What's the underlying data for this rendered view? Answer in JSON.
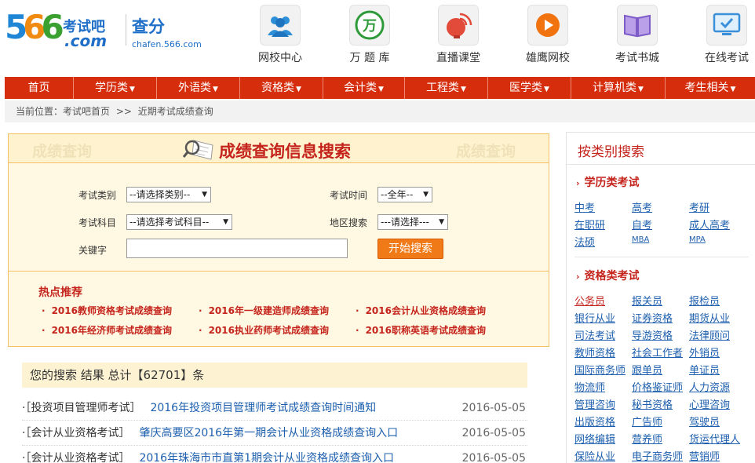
{
  "logo": {
    "digits": [
      "5",
      "6",
      "6"
    ],
    "site_name": "考试吧",
    "domain": ".com"
  },
  "chafen": {
    "title": "查分",
    "url": "chafen.566.com"
  },
  "quick_nav": [
    {
      "label": "网校中心",
      "icon": "users-icon"
    },
    {
      "label": "万 题 库",
      "icon": "question-bank-icon",
      "glyph": "万"
    },
    {
      "label": "直播课堂",
      "icon": "satellite-dish-icon"
    },
    {
      "label": "雄鹰网校",
      "icon": "play-icon"
    },
    {
      "label": "考试书城",
      "icon": "book-icon"
    },
    {
      "label": "在线考试",
      "icon": "monitor-check-icon"
    }
  ],
  "main_nav": [
    {
      "label": "首页",
      "dropdown": false
    },
    {
      "label": "学历类",
      "dropdown": true
    },
    {
      "label": "外语类",
      "dropdown": true
    },
    {
      "label": "资格类",
      "dropdown": true
    },
    {
      "label": "会计类",
      "dropdown": true
    },
    {
      "label": "工程类",
      "dropdown": true
    },
    {
      "label": "医学类",
      "dropdown": true
    },
    {
      "label": "计算机类",
      "dropdown": true
    },
    {
      "label": "考生相关",
      "dropdown": true
    }
  ],
  "breadcrumb": {
    "prefix": "当前位置：",
    "home": "考试吧首页",
    "sep": ">>",
    "current": "近期考试成绩查询"
  },
  "search": {
    "ghost_left": "成绩查询",
    "ghost_right": "成绩查询",
    "title": "成绩查询信息搜索",
    "category_label": "考试类别",
    "category_value": "--请选择类别--",
    "time_label": "考试时间",
    "time_value": "--全年--",
    "subject_label": "考试科目",
    "subject_value": "--请选择考试科目--",
    "region_label": "地区搜索",
    "region_value": "---请选择---",
    "keyword_label": "关键字",
    "keyword_value": "",
    "button": "开始搜索"
  },
  "hot": {
    "title": "热点推荐",
    "links": [
      "2016教师资格考试成绩查询",
      "2016年一级建造师成绩查询",
      "2016会计从业资格成绩查询",
      "2016年经济师考试成绩查询",
      "2016执业药师考试成绩查询",
      "2016职称英语考试成绩查询"
    ]
  },
  "results": {
    "header_prefix": "您的搜索 结果 总计【",
    "total": "62701",
    "header_suffix": "】条",
    "rows": [
      {
        "category": "·［投资项目管理师考试］",
        "title": "2016年投资项目管理师考试成绩查询时间通知",
        "date": "2016-05-05"
      },
      {
        "category": "·［会计从业资格考试］",
        "title": "肇庆高要区2016年第一期会计从业资格成绩查询入口",
        "date": "2016-05-05"
      },
      {
        "category": "·［会计从业资格考试］",
        "title": "2016年珠海市市直第1期会计从业资格成绩查询入口",
        "date": "2016-05-05"
      }
    ]
  },
  "sidebar": {
    "title": "按类别搜索",
    "sections": [
      {
        "title": "学历类考试",
        "links": [
          "中考",
          "高考",
          "考研",
          "在职研",
          "自考",
          "成人高考",
          "法硕",
          "MBA",
          "MPA"
        ]
      },
      {
        "title": "资格类考试",
        "links": [
          "公务员",
          "报关员",
          "报检员",
          "银行从业",
          "证券资格",
          "期货从业",
          "司法考试",
          "导游资格",
          "法律顾问",
          "教师资格",
          "社会工作者",
          "外销员",
          "国际商务师",
          "跟单员",
          "单证员",
          "物流师",
          "价格鉴证师",
          "人力资源",
          "管理咨询",
          "秘书资格",
          "心理咨询",
          "出版资格",
          "广告师",
          "驾驶员",
          "网络编辑",
          "营养师",
          "货运代理人",
          "保险从业",
          "电子商务师",
          "营销师"
        ]
      }
    ]
  },
  "colors": {
    "nav_red": "#d62e0c",
    "title_red": "#c4241c",
    "link_blue": "#1d5fae",
    "button_orange": "#f07a18"
  }
}
